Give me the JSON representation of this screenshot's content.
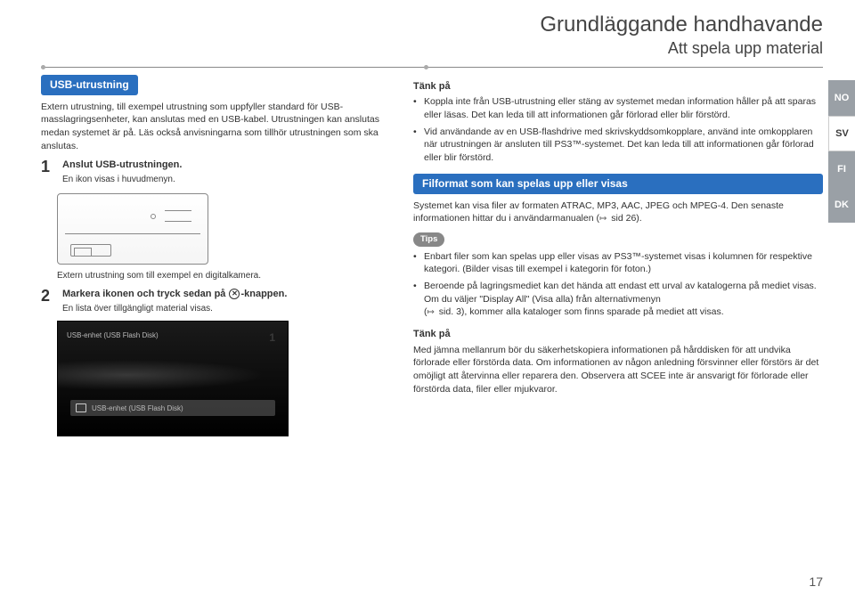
{
  "header": {
    "title": "Grundläggande handhavande",
    "subtitle": "Att spela upp material"
  },
  "left": {
    "section_title": "USB-utrustning",
    "intro": "Extern utrustning, till exempel utrustning som uppfyller standard för USB-masslagringsenheter, kan anslutas med en USB-kabel. Utrustningen kan anslutas medan systemet är på. Läs också anvisningarna som tillhör utrustningen som ska anslutas.",
    "step1_title": "Anslut USB-utrustningen.",
    "step1_sub": "En ikon visas i huvudmenyn.",
    "device_caption": "Extern utrustning som till exempel en digitalkamera.",
    "step2_title_pre": "Markera ikonen och tryck sedan på ",
    "step2_title_post": "-knappen.",
    "step2_sub": "En lista över tillgängligt material visas.",
    "screenshot_small": "USB-enhet (USB Flash Disk)",
    "screenshot_bar": "USB-enhet (USB Flash Disk)",
    "screenshot_count": "1"
  },
  "right": {
    "think_title": "Tänk på",
    "think_b1": "Koppla inte från USB-utrustning eller stäng av systemet medan information håller på att sparas eller läsas. Det kan leda till att informationen går förlorad eller blir förstörd.",
    "think_b2": "Vid användande av en USB-flashdrive med skrivskyddsomkopplare, använd inte omkopplaren när utrustningen är ansluten till PS3™-systemet. Det kan leda till att informationen går förlorad eller blir förstörd.",
    "formats_title": "Filformat som kan spelas upp eller visas",
    "formats_text_a": "Systemet kan visa filer av formaten ATRAC, MP3, AAC, JPEG och MPEG-4. Den senaste informationen hittar du i användarmanualen (",
    "formats_text_b": " sid 26).",
    "tips_label": "Tips",
    "tips_b1": "Enbart filer som kan spelas upp eller visas av PS3™-systemet visas i kolumnen för respektive kategori. (Bilder visas till exempel i kategorin för foton.)",
    "tips_b2_a": "Beroende på lagringsmediet kan det hända att endast ett urval av katalogerna på mediet visas. Om du väljer \"Display All\" (Visa alla) från alternativmenyn (",
    "tips_b2_b": " sid. 3), kommer alla kataloger som finns sparade på mediet att visas.",
    "think2_title": "Tänk på",
    "think2_text": "Med jämna mellanrum bör du säkerhetskopiera informationen på hårddisken för att undvika förlorade eller förstörda data. Om informationen av någon anledning försvinner eller förstörs är det omöjligt att återvinna eller reparera den. Observera att SCEE inte är ansvarigt för  förlorade eller förstörda data, filer eller mjukvaror."
  },
  "lang_tabs": {
    "no": "NO",
    "sv": "SV",
    "fi": "FI",
    "dk": "DK"
  },
  "page_number": "17"
}
